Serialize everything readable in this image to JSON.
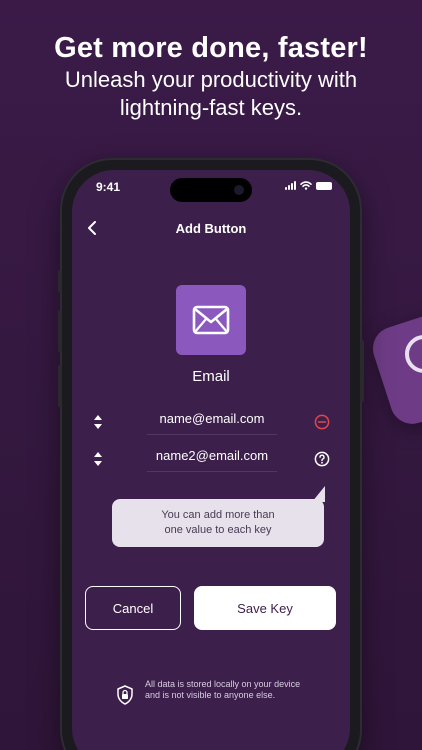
{
  "promo": {
    "headline": "Get more done, faster!",
    "subheadline": "Unleash your productivity with lightning-fast keys."
  },
  "status_bar": {
    "time": "9:41"
  },
  "nav": {
    "title": "Add Button",
    "back_icon": "chevron-left-icon"
  },
  "key": {
    "icon": "envelope-icon",
    "name": "Email",
    "icon_color": "#8b58bd"
  },
  "values": [
    {
      "value": "name@email.com",
      "action_icon": "remove-circle-icon",
      "action_color": "#e0474c"
    },
    {
      "value": "name2@email.com",
      "action_icon": "help-circle-icon",
      "action_color": "#ffffff"
    }
  ],
  "tooltip": {
    "text": "You can add more than one value to each key"
  },
  "actions": {
    "cancel_label": "Cancel",
    "save_label": "Save Key"
  },
  "privacy": {
    "icon": "lock-shield-icon",
    "note": "All data is stored locally on your device and is not visible to anyone else."
  },
  "colors": {
    "background": "#3b1a48",
    "screen": "#3d1f4c",
    "accent": "#8b58bd"
  }
}
